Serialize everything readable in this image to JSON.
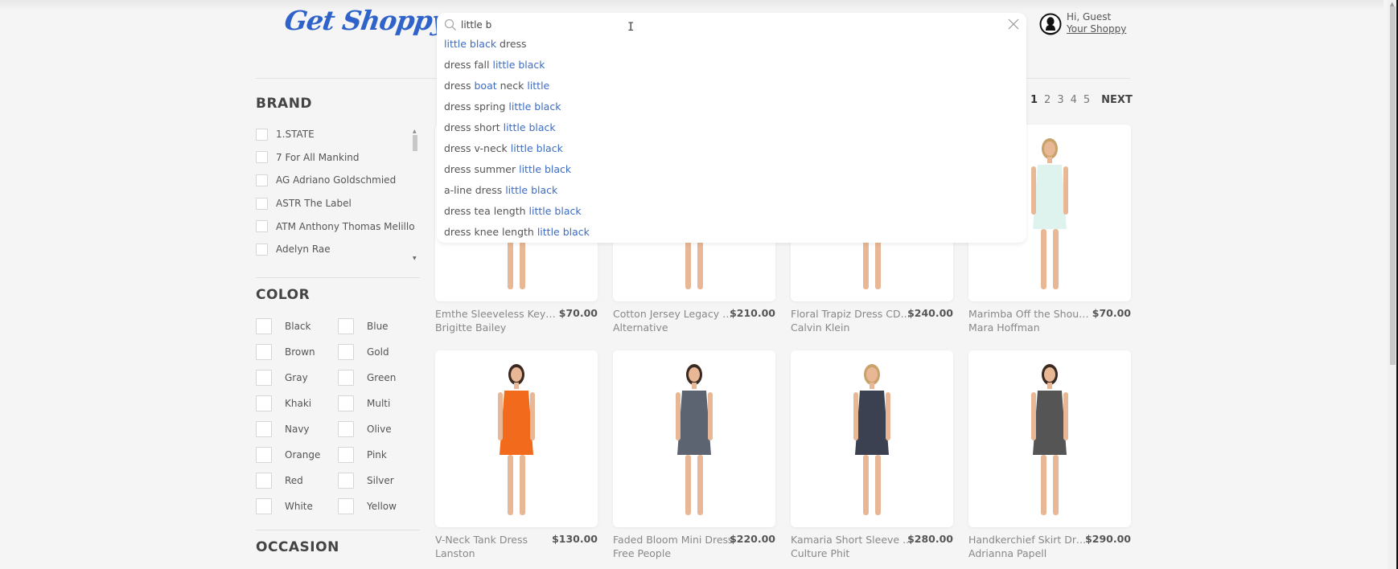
{
  "app": {
    "logo": "Get Shoppy"
  },
  "search": {
    "value": "little b",
    "placeholder": "",
    "suggestions": [
      [
        {
          "t": "little black",
          "hl": true
        },
        {
          "t": " dress",
          "hl": false
        }
      ],
      [
        {
          "t": "dress fall ",
          "hl": false
        },
        {
          "t": "little black",
          "hl": true
        }
      ],
      [
        {
          "t": "dress ",
          "hl": false
        },
        {
          "t": "boat",
          "hl": true
        },
        {
          "t": " neck ",
          "hl": false
        },
        {
          "t": "little",
          "hl": true
        }
      ],
      [
        {
          "t": "dress spring ",
          "hl": false
        },
        {
          "t": "little black",
          "hl": true
        }
      ],
      [
        {
          "t": "dress short ",
          "hl": false
        },
        {
          "t": "little black",
          "hl": true
        }
      ],
      [
        {
          "t": "dress v-neck ",
          "hl": false
        },
        {
          "t": "little black",
          "hl": true
        }
      ],
      [
        {
          "t": "dress summer ",
          "hl": false
        },
        {
          "t": "little black",
          "hl": true
        }
      ],
      [
        {
          "t": "a-line dress ",
          "hl": false
        },
        {
          "t": "little black",
          "hl": true
        }
      ],
      [
        {
          "t": "dress tea length ",
          "hl": false
        },
        {
          "t": "little black",
          "hl": true
        }
      ],
      [
        {
          "t": "dress knee length ",
          "hl": false
        },
        {
          "t": "little black",
          "hl": true
        }
      ]
    ]
  },
  "user": {
    "greeting": "Hi, Guest",
    "account_link": "Your Shoppy"
  },
  "sidebar": {
    "brand": {
      "title": "BRAND",
      "items": [
        "1.STATE",
        "7 For All Mankind",
        "AG Adriano Goldschmied",
        "ASTR The Label",
        "ATM Anthony Thomas Melillo",
        "Adelyn Rae"
      ]
    },
    "color": {
      "title": "COLOR",
      "items": [
        "Black",
        "Blue",
        "Brown",
        "Gold",
        "Gray",
        "Green",
        "Khaki",
        "Multi",
        "Navy",
        "Olive",
        "Orange",
        "Pink",
        "Red",
        "Silver",
        "White",
        "Yellow"
      ]
    },
    "occasion": {
      "title": "OCCASION"
    }
  },
  "pagination": {
    "pages": [
      "1",
      "2",
      "3",
      "4",
      "5"
    ],
    "current": "1",
    "next": "NEXT"
  },
  "products": [
    {
      "name": "Emthe Sleeveless Keyh...",
      "price": "$70.00",
      "brand": "Brigitte Bailey",
      "dress_color": "#222222"
    },
    {
      "name": "Cotton Jersey Legacy T-...",
      "price": "$210.00",
      "brand": "Alternative",
      "dress_color": "#2a2a2a"
    },
    {
      "name": "Floral Trapiz Dress CD...",
      "price": "$240.00",
      "brand": "Calvin Klein",
      "dress_color": "#333333"
    },
    {
      "name": "Marimba Off the Shoul...",
      "price": "$70.00",
      "brand": "Mara Hoffman",
      "dress_color": "#dff3ee"
    },
    {
      "name": "V-Neck Tank Dress",
      "price": "$130.00",
      "brand": "Lanston",
      "dress_color": "#f26a1b"
    },
    {
      "name": "Faded Bloom Mini Dress",
      "price": "$220.00",
      "brand": "Free People",
      "dress_color": "#5c6472"
    },
    {
      "name": "Kamaria Short Sleeve ...",
      "price": "$280.00",
      "brand": "Culture Phit",
      "dress_color": "#3b4150"
    },
    {
      "name": "Handkerchief Skirt Dress",
      "price": "$290.00",
      "brand": "Adrianna Papell",
      "dress_color": "#555555"
    }
  ],
  "colors": {
    "accent": "#3d6cc4",
    "logo": "#2f63c9"
  }
}
